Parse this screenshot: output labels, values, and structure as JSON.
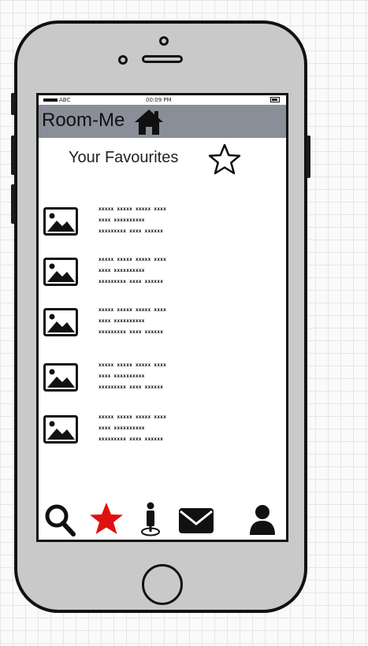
{
  "status_bar": {
    "carrier": "ABC",
    "time": "00:09 PM"
  },
  "header": {
    "title": "Room-Me",
    "home_icon": "home-icon"
  },
  "page": {
    "title": "Your Favourites",
    "title_icon": "star-outline-icon"
  },
  "favourites": [
    {
      "thumbnail_icon": "image-placeholder-icon",
      "lines": [
        "xxxxx xxxxx xxxxx xxxx",
        "xxxx xxxxxxxxxx",
        "xxxxxxxxx xxxx xxxxxx"
      ]
    },
    {
      "thumbnail_icon": "image-placeholder-icon",
      "lines": [
        "xxxxx xxxxx xxxxx xxxx",
        "xxxx xxxxxxxxxx",
        "xxxxxxxxx xxxx xxxxxx"
      ]
    },
    {
      "thumbnail_icon": "image-placeholder-icon",
      "lines": [
        "xxxxx xxxxx xxxxx xxxx",
        "xxxx xxxxxxxxxx",
        "xxxxxxxxx xxxx xxxxxx"
      ]
    },
    {
      "thumbnail_icon": "image-placeholder-icon",
      "lines": [
        "xxxxx xxxxx xxxxx xxxx",
        "xxxx xxxxxxxxxx",
        "xxxxxxxxx xxxx xxxxxx"
      ]
    },
    {
      "thumbnail_icon": "image-placeholder-icon",
      "lines": [
        "xxxxx xxxxx xxxxx xxxx",
        "xxxx xxxxxxxxxx",
        "xxxxxxxxx xxxx xxxxxx"
      ]
    }
  ],
  "tab_bar": {
    "tabs": [
      {
        "icon": "search-icon",
        "active": false
      },
      {
        "icon": "star-icon",
        "active": true
      },
      {
        "icon": "location-person-icon",
        "active": false
      },
      {
        "icon": "mail-icon",
        "active": false
      },
      {
        "icon": "user-icon",
        "active": false
      }
    ],
    "active_color": "#e01010"
  },
  "colors": {
    "header_background": "#8a8e98",
    "phone_body": "#c9c9c9"
  }
}
